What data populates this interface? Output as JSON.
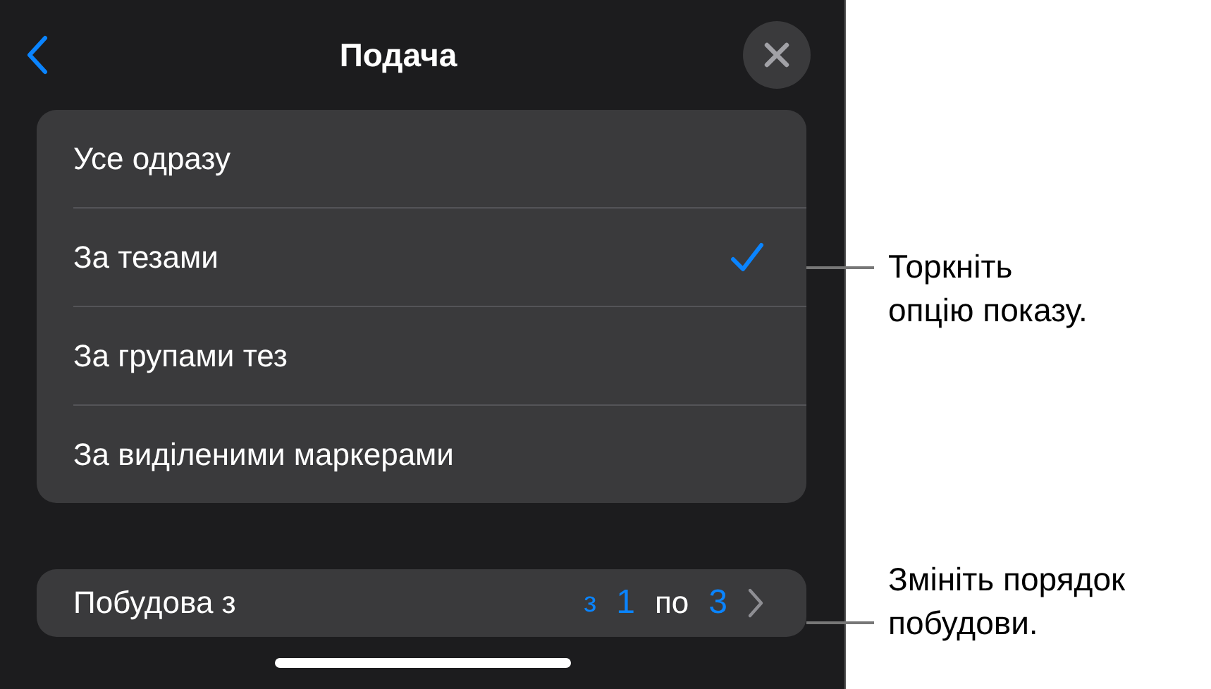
{
  "header": {
    "title": "Подача"
  },
  "options": [
    {
      "label": "Усе одразу",
      "selected": false
    },
    {
      "label": "За тезами",
      "selected": true
    },
    {
      "label": "За групами тез",
      "selected": false
    },
    {
      "label": "За виділеними маркерами",
      "selected": false
    }
  ],
  "build_row": {
    "label": "Побудова з",
    "from_prefix": "з",
    "from": "1",
    "to_prefix": "по",
    "to": "3"
  },
  "callouts": [
    {
      "lines": [
        "Торкніть",
        "опцію показу."
      ]
    },
    {
      "lines": [
        "Змініть порядок",
        "побудови."
      ]
    }
  ]
}
